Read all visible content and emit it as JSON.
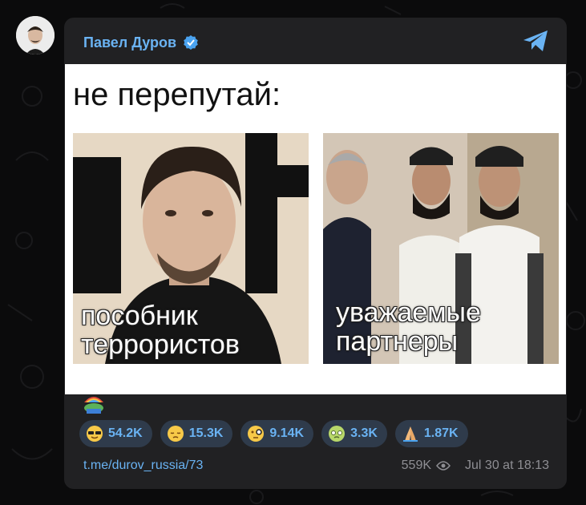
{
  "post": {
    "author": "Павел Дуров",
    "meme_title": "не перепутай:",
    "left_caption_line1": "пособник",
    "left_caption_line2": "террористов",
    "right_caption_line1": "уважаемые",
    "right_caption_line2": "партнеры",
    "link": "t.me/durov_russia/73",
    "views": "559K",
    "date": "Jul 30 at 18:13"
  },
  "reactions": [
    {
      "icon": "sunglasses-emoji-icon",
      "count": "54.2K"
    },
    {
      "icon": "pensive-emoji-icon",
      "count": "15.3K"
    },
    {
      "icon": "monocle-emoji-icon",
      "count": "9.14K"
    },
    {
      "icon": "nauseated-emoji-icon",
      "count": "3.3K"
    },
    {
      "icon": "praying-hands-icon",
      "count": "1.87K"
    }
  ],
  "colors": {
    "accent": "#6ab3f3",
    "card": "#212123",
    "reaction_bg": "#2f3b4b",
    "meta": "#8e8e93"
  }
}
